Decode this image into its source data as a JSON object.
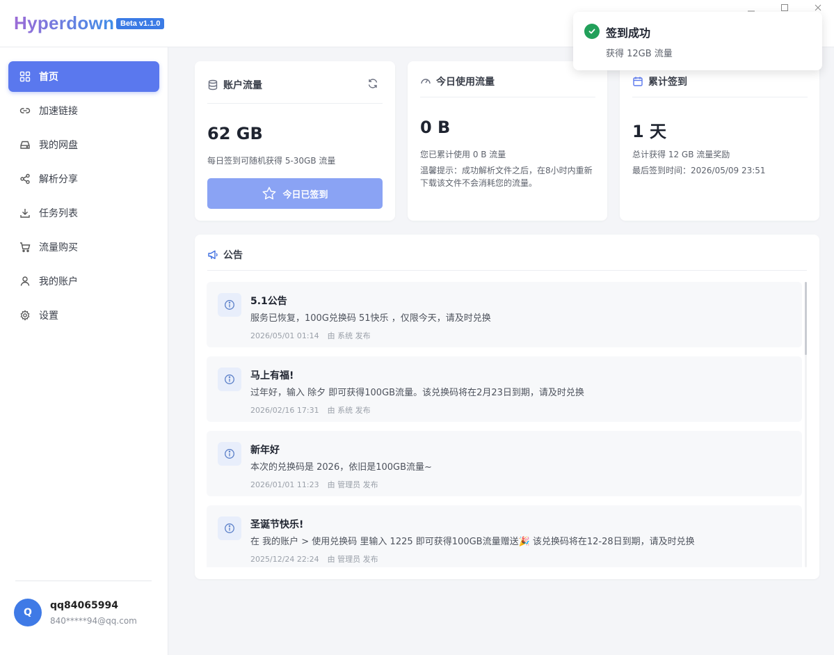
{
  "app": {
    "logo": "Hyperdown",
    "version_badge": "Beta v1.1.0"
  },
  "window_controls": [
    "minimize-icon",
    "maximize-icon",
    "close-icon"
  ],
  "sidebar": {
    "items": [
      {
        "label": "首页",
        "icon": "grid-icon",
        "active": true
      },
      {
        "label": "加速链接",
        "icon": "link-icon",
        "active": false
      },
      {
        "label": "我的网盘",
        "icon": "drive-icon",
        "active": false
      },
      {
        "label": "解析分享",
        "icon": "share-icon",
        "active": false
      },
      {
        "label": "任务列表",
        "icon": "download-icon",
        "active": false
      },
      {
        "label": "流量购买",
        "icon": "cart-icon",
        "active": false
      },
      {
        "label": "我的账户",
        "icon": "user-icon",
        "active": false
      },
      {
        "label": "设置",
        "icon": "gear-icon",
        "active": false
      }
    ],
    "user": {
      "avatar_letter": "Q",
      "name": "qq84065994",
      "email": "840*****94@qq.com"
    }
  },
  "account_traffic": {
    "title": "账户流量",
    "value": "62 GB",
    "hint": "每日签到可随机获得 5-30GB 流量",
    "checkin_button": "今日已签到"
  },
  "today_usage": {
    "title": "今日使用流量",
    "value": "0 B",
    "line1": "您已累计使用 0 B 流量",
    "line2": "温馨提示：成功解析文件之后，在8小时内重新",
    "line3": "下载该文件不会消耗您的流量。"
  },
  "checkin_total": {
    "title": "累计签到",
    "value": "1 天",
    "line1": "总计获得 12 GB 流量奖励",
    "line2": "最后签到时间：2026/05/09 23:51"
  },
  "announcements": {
    "title": "公告",
    "items": [
      {
        "title": "5.1公告",
        "body": "服务已恢复，100G兑换码 51快乐 ，仅限今天，请及时兑换",
        "date": "2026/05/01 01:14",
        "author": "由 系统 发布"
      },
      {
        "title": "马上有福!",
        "body": "过年好，输入 除夕 即可获得100GB流量。该兑换码将在2月23日到期，请及时兑换",
        "date": "2026/02/16 17:31",
        "author": "由 系统 发布"
      },
      {
        "title": "新年好",
        "body": "本次的兑换码是 2026，依旧是100GB流量~",
        "date": "2026/01/01 11:23",
        "author": "由 管理员 发布"
      },
      {
        "title": "圣诞节快乐!",
        "body": "在 我的账户 > 使用兑换码 里输入 1225 即可获得100GB流量赠送🎉 该兑换码将在12-28日到期，请及时兑换",
        "date": "2025/12/24 22:24",
        "author": "由 管理员 发布"
      }
    ]
  },
  "toast": {
    "title": "签到成功",
    "message": "获得 12GB 流量",
    "color": "#22a05a"
  },
  "colors": {
    "accent": "#5a78ee",
    "checkin_button": "#8aa3f4",
    "avatar": "#3f7ae6"
  }
}
